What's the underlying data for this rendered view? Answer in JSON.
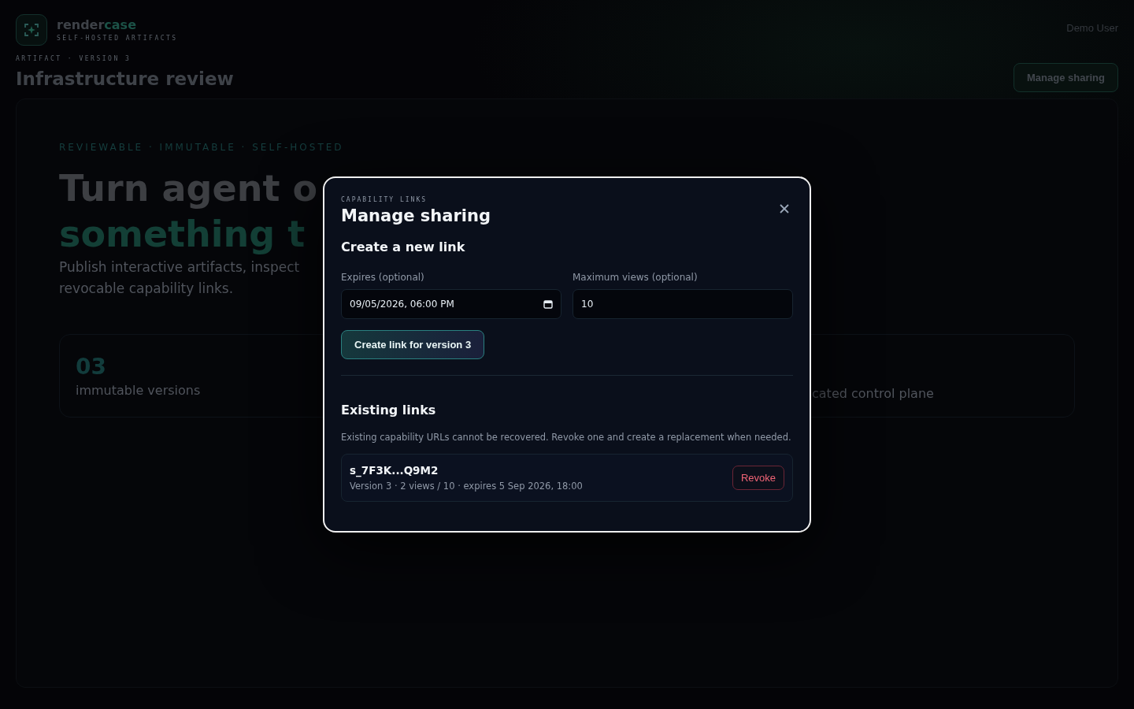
{
  "brand": {
    "name": "render",
    "name_accent": "case",
    "tagline": "SELF-HOSTED ARTIFACTS"
  },
  "user": "Demo User",
  "breadcrumb": "ARTIFACT · VERSION 3",
  "page_title": "Infrastructure review",
  "header_button": "Manage sharing",
  "hero": {
    "eyebrow": "REVIEWABLE · IMMUTABLE · SELF-HOSTED",
    "headline_1": "Turn agent o",
    "headline_2": "something t",
    "lead_1": "Publish interactive artifacts, inspect",
    "lead_2": "revocable capability links."
  },
  "stats": [
    {
      "value": "03",
      "label": "immutable versions"
    },
    {
      "label": "cated control plane"
    }
  ],
  "dialog": {
    "eyebrow": "CAPABILITY LINKS",
    "title": "Manage sharing",
    "create_heading": "Create a new link",
    "expires": {
      "label": "Expires (optional)",
      "value": "09/05/2026, 06:00 PM"
    },
    "max_views": {
      "label": "Maximum views (optional)",
      "value": "10"
    },
    "create_button": "Create link for version 3",
    "existing_heading": "Existing links",
    "existing_note": "Existing capability URLs cannot be recovered. Revoke one and create a replacement when needed.",
    "links": [
      {
        "token": "s_7F3K...Q9M2",
        "meta": "Version 3 · 2 views / 10 · expires 5 Sep 2026, 18:00",
        "action": "Revoke"
      }
    ]
  }
}
